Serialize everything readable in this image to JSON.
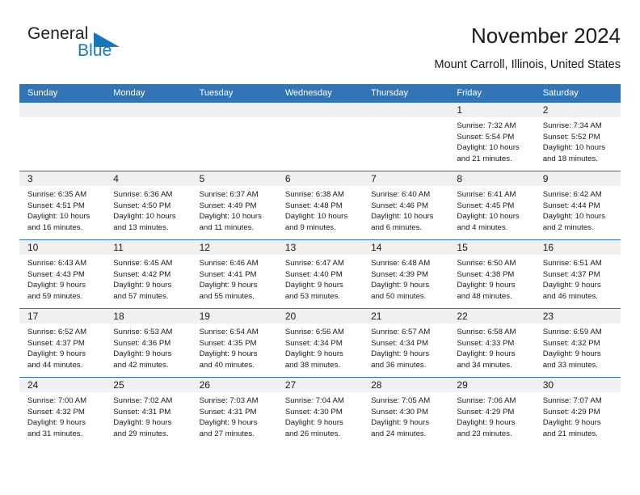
{
  "brand": {
    "name_part1": "General",
    "name_part2": "Blue",
    "triangle_color": "#1a76bc"
  },
  "header": {
    "title": "November 2024",
    "subtitle": "Mount Carroll, Illinois, United States",
    "header_bg_color": "#3275b6",
    "daynum_band_color": "#f0f0f0"
  },
  "weekday_headers": [
    "Sunday",
    "Monday",
    "Tuesday",
    "Wednesday",
    "Thursday",
    "Friday",
    "Saturday"
  ],
  "labels": {
    "sunrise_prefix": "Sunrise: ",
    "sunset_prefix": "Sunset: ",
    "daylight_prefix": "Daylight: "
  },
  "weeks": [
    [
      {
        "empty": true
      },
      {
        "empty": true
      },
      {
        "empty": true
      },
      {
        "empty": true
      },
      {
        "empty": true
      },
      {
        "day": "1",
        "sunrise": "Sunrise: 7:32 AM",
        "sunset": "Sunset: 5:54 PM",
        "daylight": "Daylight: 10 hours and 21 minutes."
      },
      {
        "day": "2",
        "sunrise": "Sunrise: 7:34 AM",
        "sunset": "Sunset: 5:52 PM",
        "daylight": "Daylight: 10 hours and 18 minutes."
      }
    ],
    [
      {
        "day": "3",
        "sunrise": "Sunrise: 6:35 AM",
        "sunset": "Sunset: 4:51 PM",
        "daylight": "Daylight: 10 hours and 16 minutes."
      },
      {
        "day": "4",
        "sunrise": "Sunrise: 6:36 AM",
        "sunset": "Sunset: 4:50 PM",
        "daylight": "Daylight: 10 hours and 13 minutes."
      },
      {
        "day": "5",
        "sunrise": "Sunrise: 6:37 AM",
        "sunset": "Sunset: 4:49 PM",
        "daylight": "Daylight: 10 hours and 11 minutes."
      },
      {
        "day": "6",
        "sunrise": "Sunrise: 6:38 AM",
        "sunset": "Sunset: 4:48 PM",
        "daylight": "Daylight: 10 hours and 9 minutes."
      },
      {
        "day": "7",
        "sunrise": "Sunrise: 6:40 AM",
        "sunset": "Sunset: 4:46 PM",
        "daylight": "Daylight: 10 hours and 6 minutes."
      },
      {
        "day": "8",
        "sunrise": "Sunrise: 6:41 AM",
        "sunset": "Sunset: 4:45 PM",
        "daylight": "Daylight: 10 hours and 4 minutes."
      },
      {
        "day": "9",
        "sunrise": "Sunrise: 6:42 AM",
        "sunset": "Sunset: 4:44 PM",
        "daylight": "Daylight: 10 hours and 2 minutes."
      }
    ],
    [
      {
        "day": "10",
        "sunrise": "Sunrise: 6:43 AM",
        "sunset": "Sunset: 4:43 PM",
        "daylight": "Daylight: 9 hours and 59 minutes."
      },
      {
        "day": "11",
        "sunrise": "Sunrise: 6:45 AM",
        "sunset": "Sunset: 4:42 PM",
        "daylight": "Daylight: 9 hours and 57 minutes."
      },
      {
        "day": "12",
        "sunrise": "Sunrise: 6:46 AM",
        "sunset": "Sunset: 4:41 PM",
        "daylight": "Daylight: 9 hours and 55 minutes."
      },
      {
        "day": "13",
        "sunrise": "Sunrise: 6:47 AM",
        "sunset": "Sunset: 4:40 PM",
        "daylight": "Daylight: 9 hours and 53 minutes."
      },
      {
        "day": "14",
        "sunrise": "Sunrise: 6:48 AM",
        "sunset": "Sunset: 4:39 PM",
        "daylight": "Daylight: 9 hours and 50 minutes."
      },
      {
        "day": "15",
        "sunrise": "Sunrise: 6:50 AM",
        "sunset": "Sunset: 4:38 PM",
        "daylight": "Daylight: 9 hours and 48 minutes."
      },
      {
        "day": "16",
        "sunrise": "Sunrise: 6:51 AM",
        "sunset": "Sunset: 4:37 PM",
        "daylight": "Daylight: 9 hours and 46 minutes."
      }
    ],
    [
      {
        "day": "17",
        "sunrise": "Sunrise: 6:52 AM",
        "sunset": "Sunset: 4:37 PM",
        "daylight": "Daylight: 9 hours and 44 minutes."
      },
      {
        "day": "18",
        "sunrise": "Sunrise: 6:53 AM",
        "sunset": "Sunset: 4:36 PM",
        "daylight": "Daylight: 9 hours and 42 minutes."
      },
      {
        "day": "19",
        "sunrise": "Sunrise: 6:54 AM",
        "sunset": "Sunset: 4:35 PM",
        "daylight": "Daylight: 9 hours and 40 minutes."
      },
      {
        "day": "20",
        "sunrise": "Sunrise: 6:56 AM",
        "sunset": "Sunset: 4:34 PM",
        "daylight": "Daylight: 9 hours and 38 minutes."
      },
      {
        "day": "21",
        "sunrise": "Sunrise: 6:57 AM",
        "sunset": "Sunset: 4:34 PM",
        "daylight": "Daylight: 9 hours and 36 minutes."
      },
      {
        "day": "22",
        "sunrise": "Sunrise: 6:58 AM",
        "sunset": "Sunset: 4:33 PM",
        "daylight": "Daylight: 9 hours and 34 minutes."
      },
      {
        "day": "23",
        "sunrise": "Sunrise: 6:59 AM",
        "sunset": "Sunset: 4:32 PM",
        "daylight": "Daylight: 9 hours and 33 minutes."
      }
    ],
    [
      {
        "day": "24",
        "sunrise": "Sunrise: 7:00 AM",
        "sunset": "Sunset: 4:32 PM",
        "daylight": "Daylight: 9 hours and 31 minutes."
      },
      {
        "day": "25",
        "sunrise": "Sunrise: 7:02 AM",
        "sunset": "Sunset: 4:31 PM",
        "daylight": "Daylight: 9 hours and 29 minutes."
      },
      {
        "day": "26",
        "sunrise": "Sunrise: 7:03 AM",
        "sunset": "Sunset: 4:31 PM",
        "daylight": "Daylight: 9 hours and 27 minutes."
      },
      {
        "day": "27",
        "sunrise": "Sunrise: 7:04 AM",
        "sunset": "Sunset: 4:30 PM",
        "daylight": "Daylight: 9 hours and 26 minutes."
      },
      {
        "day": "28",
        "sunrise": "Sunrise: 7:05 AM",
        "sunset": "Sunset: 4:30 PM",
        "daylight": "Daylight: 9 hours and 24 minutes."
      },
      {
        "day": "29",
        "sunrise": "Sunrise: 7:06 AM",
        "sunset": "Sunset: 4:29 PM",
        "daylight": "Daylight: 9 hours and 23 minutes."
      },
      {
        "day": "30",
        "sunrise": "Sunrise: 7:07 AM",
        "sunset": "Sunset: 4:29 PM",
        "daylight": "Daylight: 9 hours and 21 minutes."
      }
    ]
  ]
}
